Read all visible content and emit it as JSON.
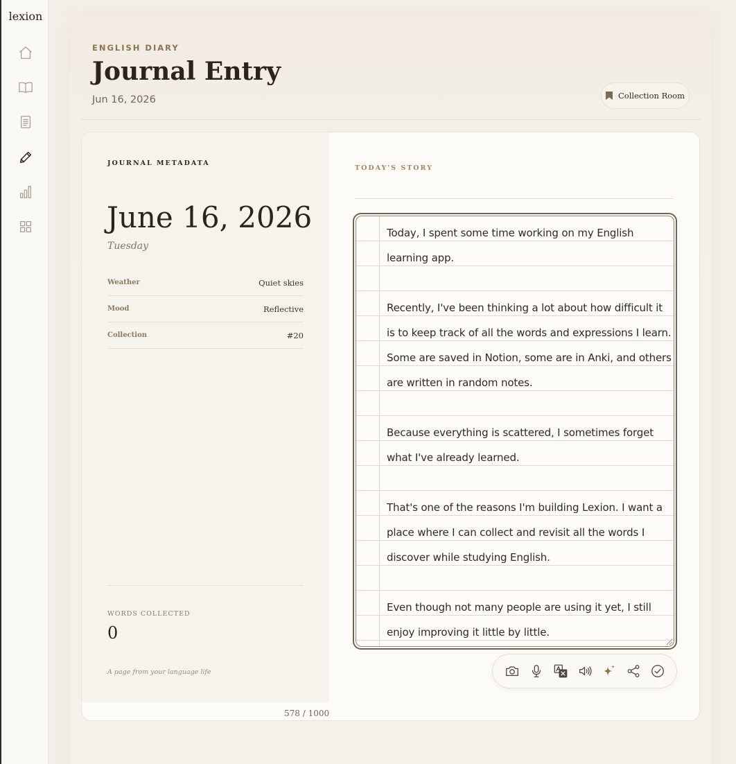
{
  "app": {
    "brand": "lexion"
  },
  "sidebar": {
    "items": [
      {
        "name": "home",
        "icon": "home-icon"
      },
      {
        "name": "book",
        "icon": "book-icon"
      },
      {
        "name": "document",
        "icon": "document-icon"
      },
      {
        "name": "journal",
        "icon": "pencil-icon",
        "active": true
      },
      {
        "name": "stats",
        "icon": "bar-chart-icon"
      },
      {
        "name": "grid",
        "icon": "grid-icon"
      }
    ]
  },
  "header": {
    "eyebrow": "ENGLISH DIARY",
    "title": "Journal Entry",
    "date": "Jun 16, 2026",
    "collection_button": "Collection Room"
  },
  "metadata": {
    "label": "JOURNAL METADATA",
    "date": "June 16, 2026",
    "weekday": "Tuesday",
    "rows": [
      {
        "key": "Weather",
        "value": "Quiet skies"
      },
      {
        "key": "Mood",
        "value": "Reflective"
      },
      {
        "key": "Collection",
        "value": "#20"
      }
    ],
    "words_label": "WORDS COLLECTED",
    "words_count": "0",
    "tagline": "A page from your language life"
  },
  "story": {
    "label": "TODAY'S STORY",
    "text": "Today, I spent some time working on my English learning app.\n\nRecently, I've been thinking a lot about how difficult it is to keep track of all the words and expressions I learn. Some are saved in Notion, some are in Anki, and others are written in random notes.\n\nBecause everything is scattered, I sometimes forget what I've already learned.\n\nThat's one of the reasons I'm building Lexion. I want a place where I can collect and revisit all the words I discover while studying English.\n\nEven though not many people are using it yet, I still enjoy improving it little by little.",
    "char_count": "578 / 1000"
  },
  "toolbar": {
    "tools": [
      "camera-icon",
      "microphone-icon",
      "translate-icon",
      "speaker-icon",
      "sparkle-icon",
      "share-icon",
      "check-circle-icon"
    ]
  },
  "colors": {
    "accent": "#8c7450",
    "background": "#f3efe8",
    "card": "#fcfbf7"
  }
}
